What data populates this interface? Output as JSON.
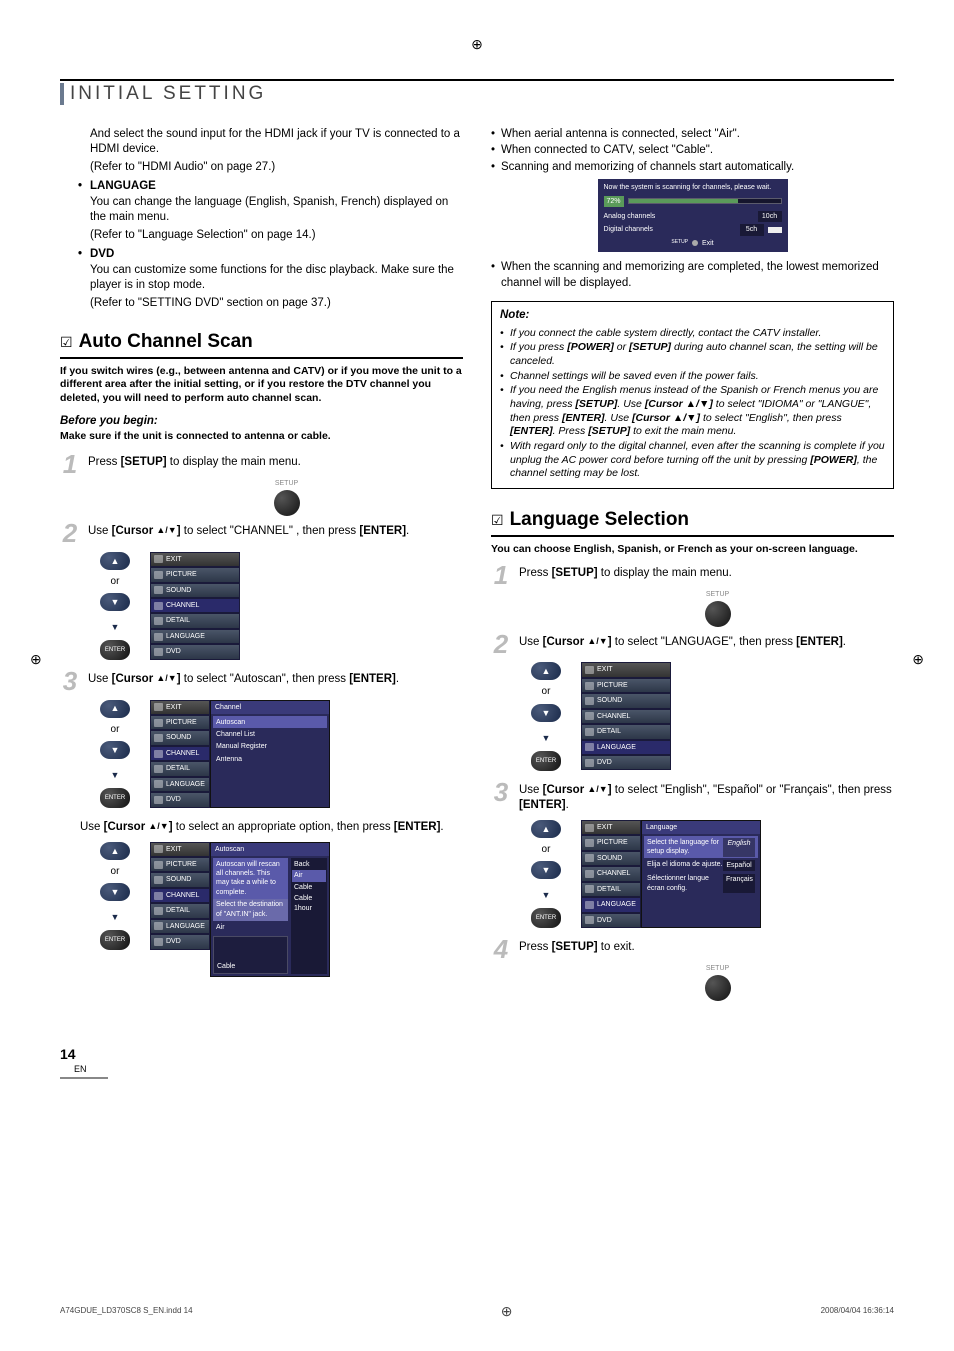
{
  "crop_mark": "⊕",
  "header": {
    "title": "INITIAL SETTING"
  },
  "leftCol": {
    "hdmi_line1": "And select the sound input for the HDMI jack if your TV is connected to a HDMI device.",
    "hdmi_line2": "(Refer to \"HDMI Audio\" on page 27.)",
    "lang_head": "LANGUAGE",
    "lang_line1": "You can change the language (English, Spanish, French) displayed on the main menu.",
    "lang_line2": "(Refer to \"Language Selection\" on page 14.)",
    "dvd_head": "DVD",
    "dvd_line1": "You can customize some functions for the disc playback. Make sure the player is in stop mode.",
    "dvd_line2": "(Refer to \"SETTING DVD\" section on page 37.)",
    "acs_head": "Auto Channel Scan",
    "acs_intro": "If you switch wires (e.g., between antenna and CATV) or if you move the unit to a different area after the initial setting, or if you restore the DTV channel you deleted, you will need to perform auto channel scan.",
    "before": "Before you begin:",
    "before_sub": "Make sure if the unit is connected to antenna or cable.",
    "step1": "Press [SETUP] to display the main menu.",
    "step1_pre": "Press ",
    "step1_b": "[SETUP]",
    "step1_post": " to display the main menu.",
    "setup_label": "SETUP",
    "step2_pre": "Use ",
    "step2_b1": "[Cursor ",
    "step2_tri": "▲/▼",
    "step2_b2": "]",
    "step2_mid": " to select \"CHANNEL\" , then press ",
    "step2_b3": "[ENTER]",
    "step2_post": ".",
    "or": "or",
    "enter_label": "ENTER",
    "step3_pre": "Use ",
    "step3_mid": " to select \"Autoscan\", then press ",
    "step3_post": ".",
    "step_opt_pre": "Use ",
    "step_opt_mid": " to select an appropriate option, then press ",
    "step_opt_post": "."
  },
  "osd_menu": {
    "exit": "EXIT",
    "picture": "PICTURE",
    "sound": "SOUND",
    "channel": "CHANNEL",
    "detail": "DETAIL",
    "language": "LANGUAGE",
    "dvd": "DVD"
  },
  "osd_channel": {
    "header": "Channel",
    "autoscan": "Autoscan",
    "channel_list": "Channel List",
    "manual_register": "Manual Register",
    "antenna": "Antenna"
  },
  "osd_autoscan": {
    "header": "Autoscan",
    "msg1": "Autoscan will rescan all channels. This may take a while to complete.",
    "msg2": "Select the destination of \"ANT.IN\" jack.",
    "air_label": "Air",
    "cable_label": "Cable",
    "art_label": "Cable",
    "back": "Back",
    "opt_air": "Air",
    "opt_cable": "Cable",
    "opt_cable1hour": "Cable 1hour"
  },
  "rightCol": {
    "bul1": "When aerial antenna is connected, select \"Air\".",
    "bul2": "When connected to CATV, select \"Cable\".",
    "bul3": "Scanning and memorizing of channels start automatically.",
    "scan": {
      "msg": "Now the system is scanning for channels, please wait.",
      "pct": "72%",
      "analog": "Analog channels",
      "analog_n": "10ch",
      "digital": "Digital channels",
      "digital_n": "5ch",
      "setup": "SETUP",
      "exit": "Exit"
    },
    "bul4": "When the scanning and memorizing are completed, the lowest memorized channel will be displayed.",
    "note_head": "Note:",
    "note1": "If you connect the cable system directly, contact the CATV installer.",
    "note2_a": "If you press ",
    "note2_b1": "[POWER]",
    "note2_mid": " or ",
    "note2_b2": "[SETUP]",
    "note2_c": " during auto channel scan, the setting will be canceled.",
    "note3": "Channel settings will be saved even if the power fails.",
    "note4_a": "If you need the English menus instead of the Spanish or French menus you are having, press ",
    "note4_setup": "[SETUP]",
    "note4_b": ". Use ",
    "note4_cur": "[Cursor ▲/▼]",
    "note4_c": " to select \"IDIOMA\" or \"LANGUE\", then press ",
    "note4_enter": "[ENTER]",
    "note4_d": ". Use ",
    "note4_e": " to select \"English\", then press ",
    "note4_f": ". Press ",
    "note4_g": " to exit the main menu.",
    "note5_a": "With regard only to the digital channel, even after the scanning is complete if you unplug the AC power cord before turning off the unit by pressing ",
    "note5_b": "[POWER]",
    "note5_c": ", the channel setting may be lost.",
    "ls_head": "Language Selection",
    "ls_intro": "You can choose English, Spanish, or French as your on-screen language.",
    "ls_step1": "Press [SETUP] to display the main menu.",
    "ls_step2_mid": " to select \"LANGUAGE\", then press ",
    "ls_step3_mid": " to select \"English\", \"Español\" or \"Français\", then press ",
    "ls_step4": "Press [SETUP] to exit.",
    "ls_step4_pre": "Press ",
    "ls_step4_b": "[SETUP]",
    "ls_step4_post": " to exit."
  },
  "osd_language": {
    "header": "Language",
    "row1": "Select the language for setup display.",
    "row1_opt": "English",
    "row2": "Elija el idioma de ajuste.",
    "row2_opt": "Español",
    "row3": "Sélectionner langue écran config.",
    "row3_opt": "Français"
  },
  "page_number": {
    "n": "14",
    "en": "EN"
  },
  "footer": {
    "left": "A74GDUE_LD370SC8 S_EN.indd   14",
    "right": "2008/04/04   16:36:14"
  }
}
